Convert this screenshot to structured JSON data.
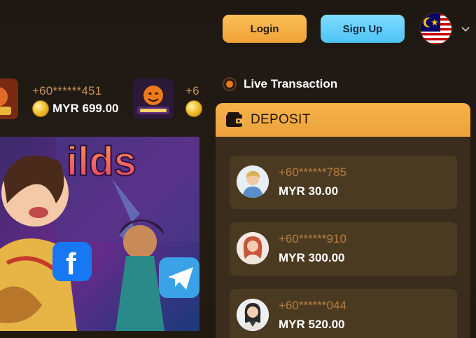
{
  "header": {
    "login_label": "Login",
    "signup_label": "Sign Up",
    "language_flag": "malaysia-flag-icon"
  },
  "ticker": {
    "items": [
      {
        "phone": "+60******451",
        "amount": "MYR 699.00"
      },
      {
        "phone": "+6",
        "amount": ""
      }
    ]
  },
  "live": {
    "title": "Live Transaction",
    "deposit_title": "DEPOSIT",
    "transactions": [
      {
        "phone": "+60******785",
        "amount": "MYR 30.00"
      },
      {
        "phone": "+60******910",
        "amount": "MYR 300.00"
      },
      {
        "phone": "+60******044",
        "amount": "MYR 520.00"
      }
    ]
  },
  "colors": {
    "login_button": "#f0a237",
    "signup_button": "#4ec3f6",
    "deposit_header": "#f6b24a",
    "card_bg": "#4a3a21",
    "phone_text": "#b77e3f"
  }
}
